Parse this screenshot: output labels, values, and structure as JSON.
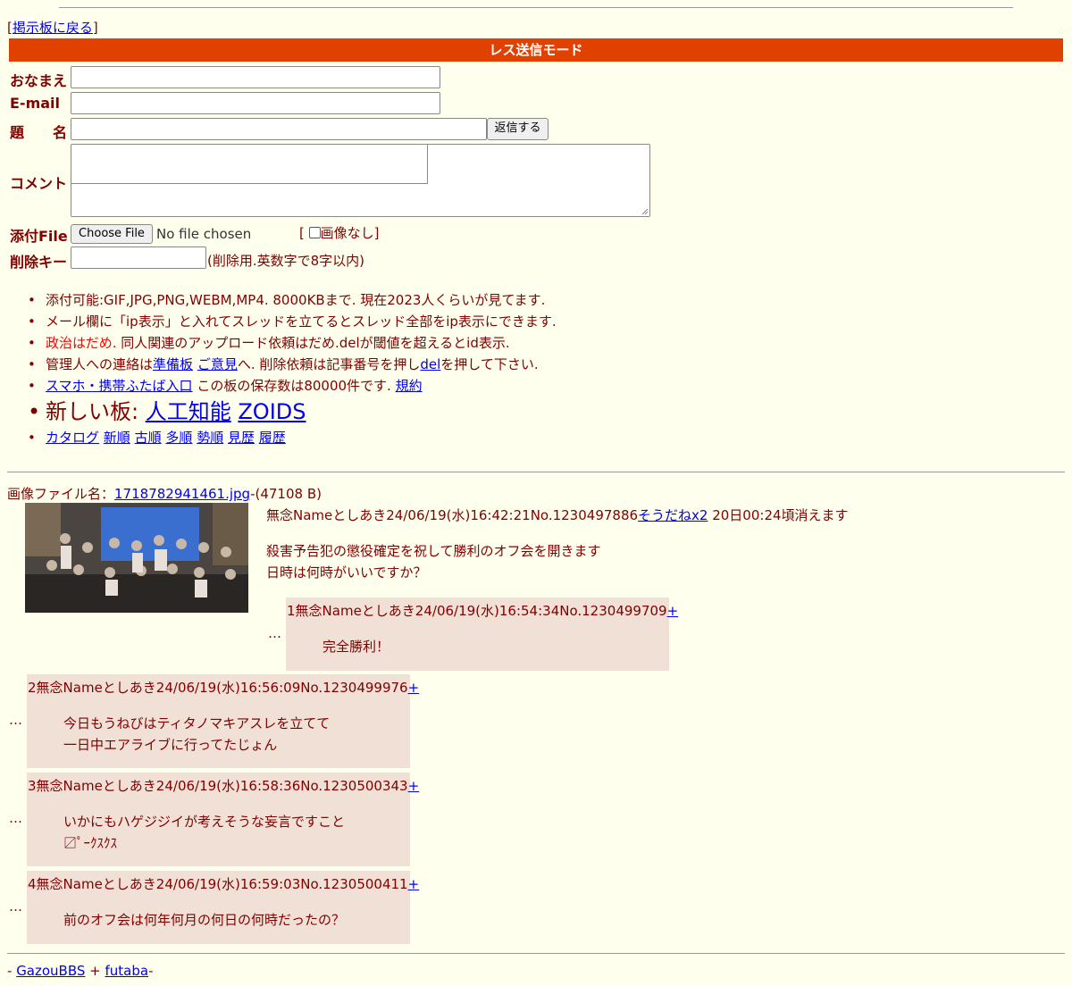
{
  "nav": {
    "back_label": "掲示板に戻る",
    "back_open": "[",
    "back_close": "]"
  },
  "form": {
    "mode_title": "レス送信モード",
    "name_label": "おなまえ",
    "email_label": "E-mail",
    "subject_label": "題　　名",
    "submit_label": "返信する",
    "comment_label": "コメント",
    "file_label": "添付File",
    "choose_file_label": "Choose File",
    "no_file_text": "No file chosen",
    "no_image_label": "画像なし",
    "delkey_label": "削除キー",
    "delkey_hint": "(削除用.英数字で8字以内)"
  },
  "notes": {
    "n1": "添付可能:GIF,JPG,PNG,WEBM,MP4. 8000KBまで. 現在2023人くらいが見てます.",
    "n2": "メール欄に「ip表示」と入れてスレッドを立てるとスレッド全部をip表示にできます.",
    "n3_red": "政治はだめ.",
    "n3_rest": " 同人関連のアップロード依頼はだめ.delが閾値を超えるとid表示.",
    "n4_a": "管理人への連絡は",
    "n4_link1": "準備板",
    "n4_link2": "ご意見",
    "n4_b": "へ. 削除依頼は記事番号を押し",
    "n4_link3": "del",
    "n4_c": "を押して下さい.",
    "n5_link": "スマホ・携帯ふたば入口",
    "n5_text": " この板の保存数は80000件です. ",
    "n5_link2": "規約",
    "n6_text": "新しい板: ",
    "n6_link1": "人工知能",
    "n6_link2": "ZOIDS",
    "n7_links": [
      "カタログ",
      "新順",
      "古順",
      "多順",
      "勢順",
      "見歴",
      "履歴"
    ]
  },
  "thread": {
    "file_label": "画像ファイル名：",
    "file_name": "1718782941461.jpg",
    "file_size": "-(47108 B)",
    "op_header": "無念Nameとしあき24/06/19(水)16:42:21No.1230497886",
    "op_sodane": "そうだねx2",
    "op_expire": " 20日00:24頃消えます",
    "op_line1": "殺害予告犯の懲役確定を祝して勝利のオフ会を開きます",
    "op_line2": "日時は何時がいいですか？",
    "replies": [
      {
        "header": "1無念Nameとしあき24/06/19(水)16:54:34No.1230499709",
        "plus": "+",
        "line1": "完全勝利！",
        "line2": ""
      },
      {
        "header": "2無念Nameとしあき24/06/19(水)16:56:09No.1230499976",
        "plus": "+",
        "line1": "今日もうねびはティタノマキアスレを立てて",
        "line2": "一日中エアライブに行ってたじょん"
      },
      {
        "header": "3無念Nameとしあき24/06/19(水)16:58:36No.1230500343",
        "plus": "+",
        "line1": "いかにもハゲジジイが考えそうな妄言ですこと",
        "line2": "〼ﾟｰｸｽｸｽ"
      },
      {
        "header": "4無念Nameとしあき24/06/19(水)16:59:03No.1230500411",
        "plus": "+",
        "line1": "前のオフ会は何年何月の何日の何時だったの？",
        "line2": ""
      }
    ],
    "dots": "…"
  },
  "footer": {
    "dash1": "- ",
    "link1": "GazouBBS",
    "plus": " + ",
    "link2": "futaba",
    "dash2": "-"
  }
}
